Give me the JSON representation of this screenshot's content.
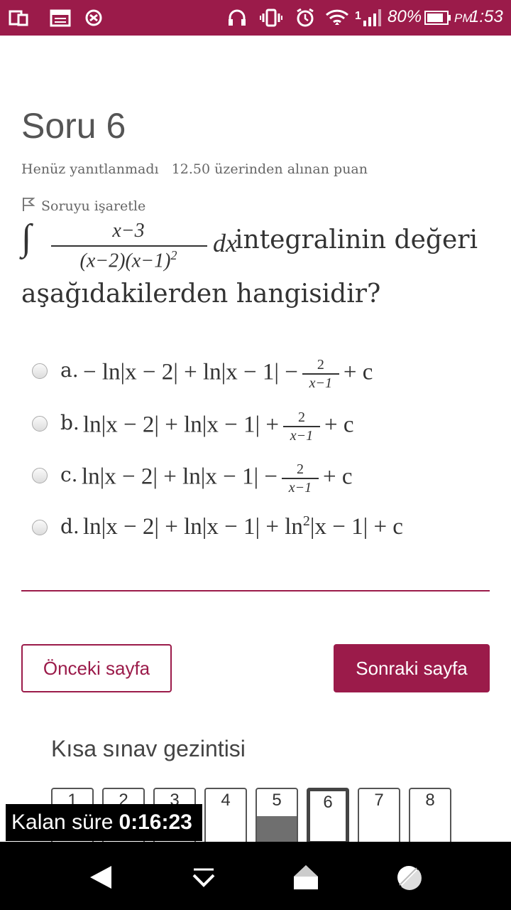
{
  "status_bar": {
    "battery": "80%",
    "time_period": "PM",
    "time": "1:53",
    "signal_number": "1",
    "bg_color": "#9b1b4a"
  },
  "question": {
    "title": "Soru 6",
    "status": "Henüz yanıtlanmadı",
    "points": "12.50 üzerinden alınan puan",
    "flag_label": "Soruyu işaretle",
    "integral_symbol": "∫",
    "numerator": "x−3",
    "denominator": "(x−2)(x−1)",
    "denominator_exp": "2",
    "dx": "dx",
    "text_part1": "integralinin değeri",
    "text_part2": "aşağıdakilerden hangisidir?"
  },
  "options": [
    {
      "letter": "a.",
      "pre": "− ln|x − 2| + ln|x − 1| −",
      "frac_num": "2",
      "frac_den": "x−1",
      "post": "+ c"
    },
    {
      "letter": "b.",
      "pre": "ln|x − 2| + ln|x − 1| +",
      "frac_num": "2",
      "frac_den": "x−1",
      "post": "+ c"
    },
    {
      "letter": "c.",
      "pre": "ln|x − 2| + ln|x − 1| −",
      "frac_num": "2",
      "frac_den": "x−1",
      "post": "+ c"
    },
    {
      "letter": "d.",
      "pre": "ln|x − 2| + ln|x − 1| + ln",
      "sup": "2",
      "post": "|x − 1| + c"
    }
  ],
  "nav": {
    "prev_label": "Önceki sayfa",
    "next_label": "Sonraki sayfa",
    "accent_color": "#9b1b4a"
  },
  "quiz_nav": {
    "title": "Kısa sınav gezintisi",
    "buttons": [
      "1",
      "2",
      "3",
      "4",
      "5",
      "6",
      "7",
      "8"
    ],
    "current": "6",
    "answered": [
      "5"
    ]
  },
  "timer": {
    "label": "Kalan süre",
    "value": "0:16:23"
  }
}
